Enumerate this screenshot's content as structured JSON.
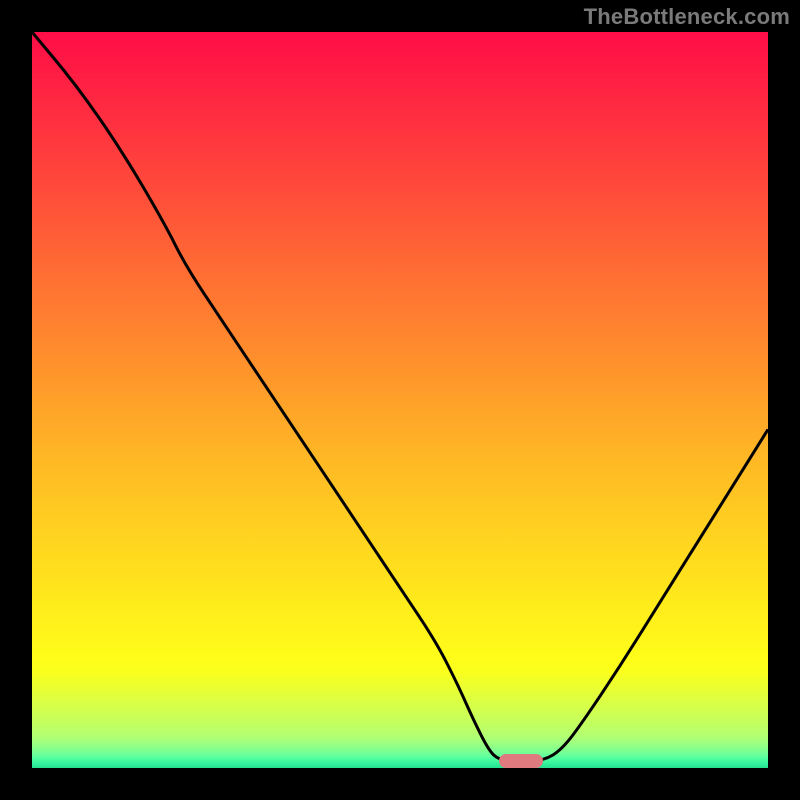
{
  "watermark": "TheBottleneck.com",
  "colors": {
    "background_black": "#000000",
    "marker_fill": "#df7a7f",
    "curve_stroke": "#000000",
    "watermark_text": "#7a7a7a"
  },
  "gradient_stops": [
    {
      "pos": 0.0,
      "color": "#ff0e47"
    },
    {
      "pos": 0.02,
      "color": "#ff1346"
    },
    {
      "pos": 0.05,
      "color": "#ff1b44"
    },
    {
      "pos": 0.1,
      "color": "#ff2a41"
    },
    {
      "pos": 0.15,
      "color": "#ff383e"
    },
    {
      "pos": 0.2,
      "color": "#ff473b"
    },
    {
      "pos": 0.25,
      "color": "#ff5638"
    },
    {
      "pos": 0.3,
      "color": "#ff6535"
    },
    {
      "pos": 0.35,
      "color": "#ff7432"
    },
    {
      "pos": 0.4,
      "color": "#ff822f"
    },
    {
      "pos": 0.45,
      "color": "#ff912c"
    },
    {
      "pos": 0.5,
      "color": "#ffa029"
    },
    {
      "pos": 0.55,
      "color": "#ffaf27"
    },
    {
      "pos": 0.58,
      "color": "#ffb825"
    },
    {
      "pos": 0.62,
      "color": "#ffc223"
    },
    {
      "pos": 0.66,
      "color": "#ffcd21"
    },
    {
      "pos": 0.7,
      "color": "#ffd71f"
    },
    {
      "pos": 0.74,
      "color": "#ffe11d"
    },
    {
      "pos": 0.78,
      "color": "#ffec1b"
    },
    {
      "pos": 0.82,
      "color": "#fff51a"
    },
    {
      "pos": 0.85,
      "color": "#fffd19"
    },
    {
      "pos": 0.868,
      "color": "#fbff1c"
    },
    {
      "pos": 0.878,
      "color": "#f3ff26"
    },
    {
      "pos": 0.888,
      "color": "#ecff2f"
    },
    {
      "pos": 0.898,
      "color": "#e4ff39"
    },
    {
      "pos": 0.908,
      "color": "#dcff42"
    },
    {
      "pos": 0.918,
      "color": "#d4ff4b"
    },
    {
      "pos": 0.928,
      "color": "#ccff55"
    },
    {
      "pos": 0.938,
      "color": "#c4ff5e"
    },
    {
      "pos": 0.948,
      "color": "#bbff68"
    },
    {
      "pos": 0.958,
      "color": "#b0ff74"
    },
    {
      "pos": 0.968,
      "color": "#9bff82"
    },
    {
      "pos": 0.978,
      "color": "#78ff94"
    },
    {
      "pos": 0.986,
      "color": "#55ffa0"
    },
    {
      "pos": 0.993,
      "color": "#34f59d"
    },
    {
      "pos": 1.0,
      "color": "#26e08f"
    }
  ],
  "marker": {
    "x_frac": 0.665,
    "y_frac": 0.991
  },
  "chart_data": {
    "type": "line",
    "title": "",
    "xlabel": "",
    "ylabel": "",
    "xlim": [
      0,
      100
    ],
    "ylim": [
      0,
      100
    ],
    "grid": false,
    "legend": false,
    "series": [
      {
        "name": "bottleneck-curve",
        "points": [
          {
            "x": 0.0,
            "y": 100.0
          },
          {
            "x": 6.0,
            "y": 92.8
          },
          {
            "x": 12.0,
            "y": 84.2
          },
          {
            "x": 18.0,
            "y": 74.0
          },
          {
            "x": 21.0,
            "y": 68.0
          },
          {
            "x": 26.0,
            "y": 60.5
          },
          {
            "x": 32.0,
            "y": 51.5
          },
          {
            "x": 38.0,
            "y": 42.5
          },
          {
            "x": 44.0,
            "y": 33.5
          },
          {
            "x": 50.0,
            "y": 24.5
          },
          {
            "x": 55.0,
            "y": 17.0
          },
          {
            "x": 58.0,
            "y": 11.0
          },
          {
            "x": 60.0,
            "y": 6.5
          },
          {
            "x": 62.0,
            "y": 2.5
          },
          {
            "x": 63.5,
            "y": 1.0
          },
          {
            "x": 66.5,
            "y": 1.0
          },
          {
            "x": 69.5,
            "y": 1.0
          },
          {
            "x": 72.0,
            "y": 2.5
          },
          {
            "x": 75.0,
            "y": 6.5
          },
          {
            "x": 80.0,
            "y": 14.0
          },
          {
            "x": 85.0,
            "y": 22.0
          },
          {
            "x": 90.0,
            "y": 30.0
          },
          {
            "x": 95.0,
            "y": 38.0
          },
          {
            "x": 100.0,
            "y": 46.0
          }
        ]
      }
    ],
    "annotations": [
      {
        "type": "pill-marker",
        "x": 66.5,
        "y": 0.9,
        "color": "#df7a7f"
      }
    ]
  }
}
